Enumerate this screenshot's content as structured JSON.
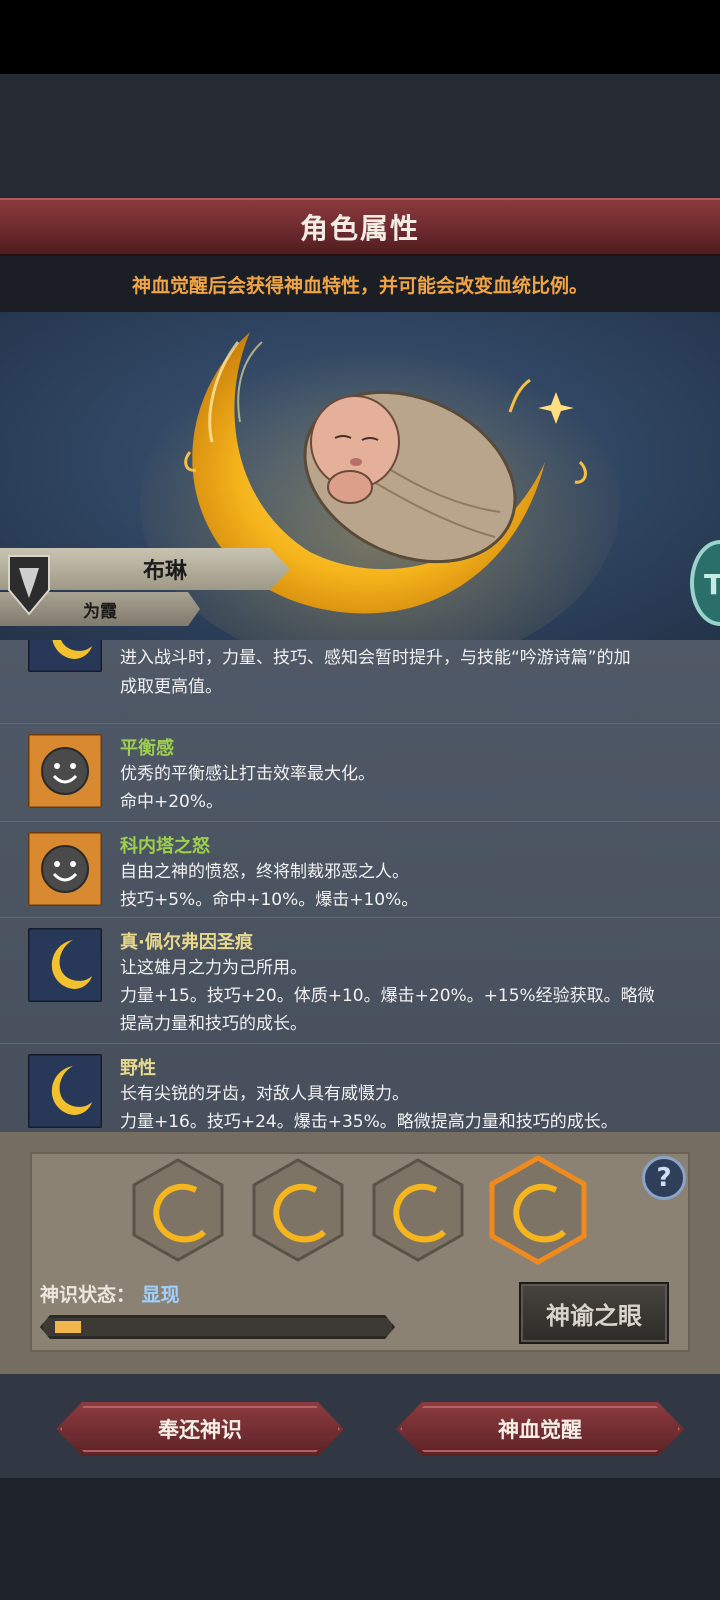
{
  "header": {
    "title": "角色属性",
    "notice": "神血觉醒后会获得神血特性，并可能会改变血统比例。"
  },
  "character": {
    "name": "布琳",
    "subtitle": "为霞",
    "side_badge_text": "T"
  },
  "traits": [
    {
      "icon": "crescent-moon-icon",
      "name": "",
      "name_color": "#e7d88b",
      "lines": [
        "进入战斗时，力量、技巧、感知会暂时提升，与技能“吟游诗篇”的加",
        "成取更高值。"
      ]
    },
    {
      "icon": "smiley-face-icon",
      "name": "平衡感",
      "name_color": "#9ccf4d",
      "lines": [
        "优秀的平衡感让打击效率最大化。",
        "命中+20%。"
      ]
    },
    {
      "icon": "smiley-face-icon",
      "name": "科内塔之怒",
      "name_color": "#9ccf4d",
      "lines": [
        "自由之神的愤怒，终将制裁邪恶之人。",
        "技巧+5%。命中+10%。爆击+10%。"
      ]
    },
    {
      "icon": "crescent-moon-icon",
      "name": "真·佩尔弗因圣痕",
      "name_color": "#e7d88b",
      "lines": [
        "让这雄月之力为己所用。",
        "力量+15。技巧+20。体质+10。爆击+20%。+15%经验获取。略微",
        "提高力量和技巧的成长。"
      ]
    },
    {
      "icon": "crescent-moon-icon",
      "name": "野性",
      "name_color": "#e7d88b",
      "lines": [
        "长有尖锐的牙齿，对敌人具有威慑力。",
        "力量+16。技巧+24。爆击+35%。略微提高力量和技巧的成长。"
      ]
    }
  ],
  "slots": {
    "icons": [
      "crescent-moon-icon",
      "crescent-moon-icon",
      "crescent-moon-icon",
      "crescent-moon-icon"
    ],
    "selected_index": 3,
    "help_label": "?"
  },
  "status": {
    "label": "神识状态：",
    "value": "显现",
    "progress_fraction": 0.08
  },
  "buttons": {
    "oracle_eye": "神谕之眼",
    "return": "奉还神识",
    "awaken": "神血觉醒"
  },
  "colors": {
    "accent_gold": "#f3b64d",
    "notice_orange": "#f0a445",
    "title_red": "#6d2a2e",
    "status_blue": "#9fd0ff"
  }
}
